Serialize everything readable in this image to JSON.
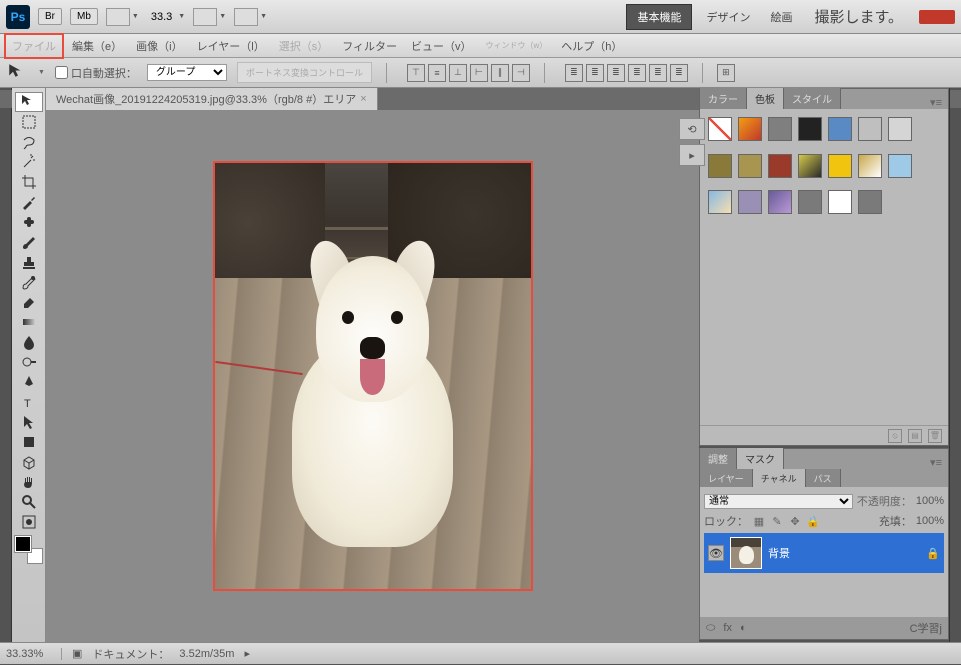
{
  "topbar": {
    "logo": "Ps",
    "br": "Br",
    "mb": "Mb",
    "zoom": "33.3",
    "mode_basic": "基本機能",
    "mode_design": "デザイン",
    "mode_paint": "絵画",
    "photo_label": "撮影します。"
  },
  "menu": {
    "file": "ファイル",
    "edit": "編集（e）",
    "image": "画像（i）",
    "layer": "レイヤー（l）",
    "select": "選択（s）",
    "filter": "フィルター",
    "view": "ビュー（v）",
    "window": "ウィンドウ（w）",
    "help": "ヘルプ（h）"
  },
  "options": {
    "auto_select": "口自動選択：",
    "group": "グループ",
    "transform_ctrl": "ポートネス変換コントロール"
  },
  "document": {
    "tab": "Wechat画像_20191224205319.jpg@33.3%（rgb/8 #）エリア"
  },
  "swatch_tabs": {
    "color": "カラー",
    "swatches": "色板",
    "styles": "スタイル"
  },
  "masks": {
    "adjust": "調整",
    "mask": "マスク"
  },
  "channels": {
    "layers": "レイヤー",
    "channels": "チャネル",
    "paths": "パス"
  },
  "layers": {
    "mode": "通常",
    "opacity_label": "不透明度：",
    "opacity": "100%",
    "lock_label": "ロック：",
    "fill_label": "充填：",
    "fill": "100%",
    "bg_layer": "背景"
  },
  "status": {
    "zoom": "33.33%",
    "doc_label": "ドキュメント：",
    "doc_size": "3.52m/35m",
    "learn": "C学習j"
  },
  "swatches": [
    "none",
    "#f39c12-#c0392b",
    "#7f7f7f",
    "#222",
    "#5a8ac4",
    "#bfbfbf",
    "#d5d5d5",
    "#8a7a3a",
    "#a89550",
    "#9a3a2a",
    "#d4c84a-#2a2a2a",
    "#f1c40f",
    "#c9a84a-#fff",
    "#9ecae8",
    "#87b8e0-#f5deb3",
    "#9a8fb5",
    "#6a5a9a-#b89ad4",
    "#7a7a7a",
    "#fff",
    "#7a7a7a"
  ]
}
